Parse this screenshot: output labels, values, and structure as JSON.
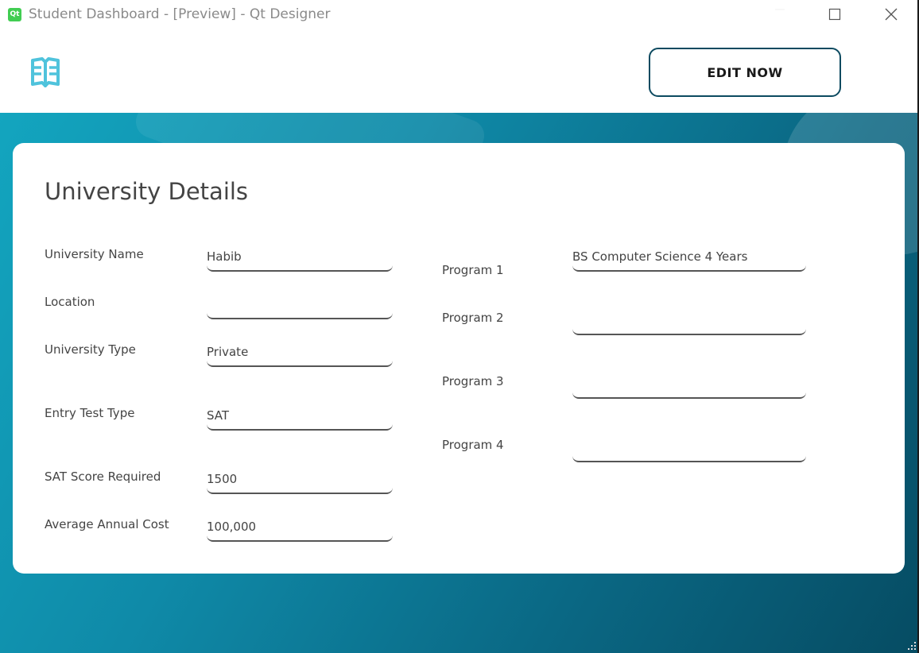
{
  "window": {
    "title": "Student Dashboard - [Preview] - Qt Designer",
    "app_icon_text": "Qt"
  },
  "header": {
    "logo_icon": "open-book-icon",
    "edit_button_label": "EDIT NOW"
  },
  "card": {
    "title": "University Details",
    "left_fields": [
      {
        "label": "University Name",
        "value": "Habib"
      },
      {
        "label": "Location",
        "value": ""
      },
      {
        "label": "University Type",
        "value": "Private"
      },
      {
        "label": "Entry Test Type",
        "value": "SAT"
      },
      {
        "label": "SAT Score Required",
        "value": "1500"
      },
      {
        "label": "Average Annual Cost",
        "value": "100,000"
      }
    ],
    "right_fields": [
      {
        "label": "Program 1",
        "value": "BS Computer Science 4 Years"
      },
      {
        "label": "Program 2",
        "value": ""
      },
      {
        "label": "Program 3",
        "value": ""
      },
      {
        "label": "Program 4",
        "value": ""
      }
    ]
  },
  "colors": {
    "accent": "#0c4a60",
    "gradient_start": "#13a5bf",
    "gradient_end": "#064c63",
    "logo": "#4fc3dc"
  }
}
